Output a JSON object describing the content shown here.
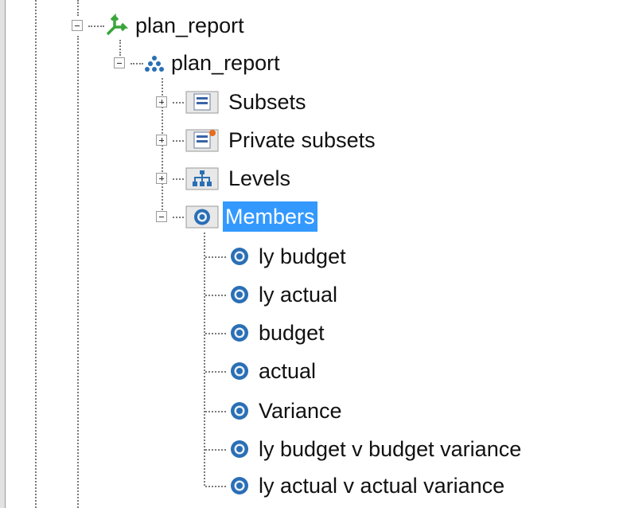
{
  "tree": {
    "cube": {
      "label": "plan_report",
      "icon": "cube-icon"
    },
    "dimension": {
      "label": "plan_report",
      "icon": "hierarchy-icon"
    },
    "folders": [
      {
        "label": "Subsets",
        "icon": "subset-icon"
      },
      {
        "label": "Private subsets",
        "icon": "private-subset-icon"
      },
      {
        "label": "Levels",
        "icon": "levels-icon"
      },
      {
        "label": "Members",
        "icon": "member-icon",
        "selected": true
      }
    ],
    "members": [
      {
        "label": "ly budget"
      },
      {
        "label": "ly actual"
      },
      {
        "label": "budget"
      },
      {
        "label": "actual"
      },
      {
        "label": "Variance"
      },
      {
        "label": "ly budget v budget variance"
      },
      {
        "label": "ly actual v actual variance"
      }
    ]
  },
  "colors": {
    "selection": "#3399ff",
    "member": "#2a6fb5",
    "cube": "#3aa53a"
  }
}
